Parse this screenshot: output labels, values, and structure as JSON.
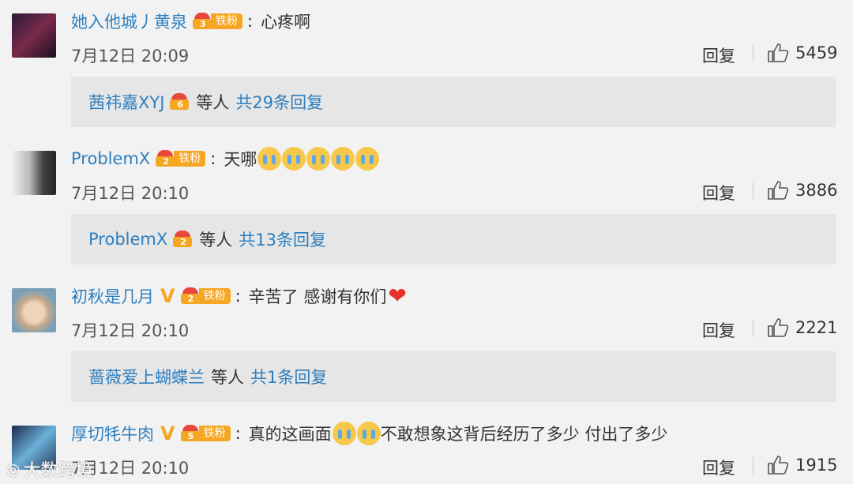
{
  "comments": [
    {
      "user": "她入他城丿黄泉",
      "fan_level": "3",
      "fan_label": "铁粉",
      "text": "心疼啊",
      "time": "7月12日 20:09",
      "reply_label": "回复",
      "likes": "5459",
      "reply_preview": {
        "name": "茜祎嘉XYJ",
        "middle": "等人",
        "count": "共29条回复"
      }
    },
    {
      "user": "ProblemX",
      "fan_level": "2",
      "fan_label": "铁粉",
      "text": "天哪",
      "time": "7月12日 20:10",
      "reply_label": "回复",
      "likes": "3886",
      "reply_preview": {
        "name": "ProblemX",
        "middle": "等人",
        "count": "共13条回复"
      }
    },
    {
      "user": "初秋是几月",
      "verified": "V",
      "fan_level": "2",
      "fan_label": "铁粉",
      "text": "辛苦了 感谢有你们",
      "time": "7月12日 20:10",
      "reply_label": "回复",
      "likes": "2221",
      "reply_preview": {
        "name": "蔷薇爱上蝴蝶兰",
        "middle": "等人",
        "count": "共1条回复"
      }
    },
    {
      "user": "厚切牦牛肉",
      "verified": "V",
      "fan_level": "5",
      "fan_label": "铁粉",
      "text": "真的这画面",
      "text2": "不敢想象这背后经历了多少  付出了多少",
      "time": "7月12日 20:10",
      "reply_label": "回复",
      "likes": "1915"
    }
  ],
  "watermark": "大数跨境",
  "colors": {
    "link": "#2d7fbf",
    "badge": "#f5a623",
    "background": "#f2f2f2",
    "reply_box": "#e6e6e6"
  }
}
